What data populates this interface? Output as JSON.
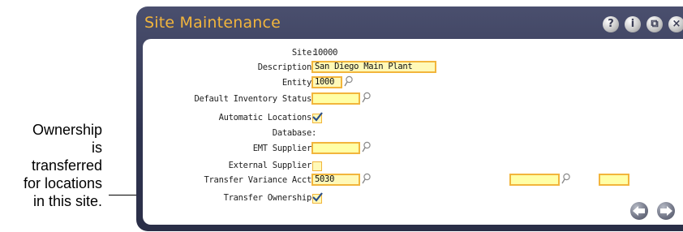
{
  "callout": {
    "lines": [
      "Ownership",
      "is",
      "transferred",
      "for locations",
      "in this site."
    ]
  },
  "window": {
    "title": "Site Maintenance",
    "title_buttons": [
      "?",
      "i",
      "⧉",
      "×"
    ]
  },
  "form": {
    "site": {
      "label": "Site:",
      "value": "10000"
    },
    "description": {
      "label": "Description:",
      "value": "San Diego Main Plant"
    },
    "entity": {
      "label": "Entity:",
      "value": "1000"
    },
    "default_inventory_status": {
      "label": "Default Inventory Status:",
      "value": ""
    },
    "automatic_locations": {
      "label": "Automatic Locations:",
      "checked": true
    },
    "database": {
      "label": "Database:",
      "value": ""
    },
    "emt_supplier": {
      "label": "EMT Supplier:",
      "value": ""
    },
    "external_supplier": {
      "label": "External Supplier:",
      "checked": false
    },
    "transfer_variance_acct": {
      "label": "Transfer Variance Acct:",
      "value": "5030",
      "sub_account": "",
      "cost_center": ""
    },
    "transfer_ownership": {
      "label": "Transfer Ownership:",
      "checked": true
    }
  },
  "colors": {
    "accent": "#f2b53c",
    "field_bg": "#fff9b8",
    "title_bar": "#2f3450",
    "check": "#2a4f8a"
  },
  "icons": {
    "lookup": "magnifier-icon",
    "prev": "arrow-left-icon",
    "next": "arrow-right-icon"
  }
}
